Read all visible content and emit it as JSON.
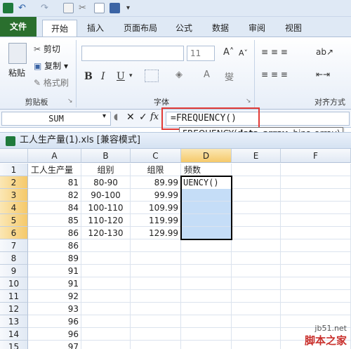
{
  "quick_access": {
    "icons": [
      "excel-icon",
      "undo-icon",
      "redo-icon",
      "print-preview-icon",
      "tools-icon",
      "new-icon",
      "save-icon",
      "customize-icon"
    ]
  },
  "ribbon_tabs": [
    {
      "label": "文件",
      "active": false
    },
    {
      "label": "开始",
      "active": true
    },
    {
      "label": "插入",
      "active": false
    },
    {
      "label": "页面布局",
      "active": false
    },
    {
      "label": "公式",
      "active": false
    },
    {
      "label": "数据",
      "active": false
    },
    {
      "label": "审阅",
      "active": false
    },
    {
      "label": "视图",
      "active": false
    }
  ],
  "ribbon": {
    "clipboard": {
      "paste_label": "粘贴",
      "cut_label": "剪切",
      "copy_label": "复制",
      "format_painter_label": "格式刷",
      "group_label": "剪贴板"
    },
    "font": {
      "font_name": "",
      "font_size": "11",
      "bold": "B",
      "italic": "I",
      "underline": "U",
      "group_label": "字体"
    },
    "alignment": {
      "group_label": "对齐方式"
    }
  },
  "formula_bar": {
    "name_box": "SUM",
    "fx_label": "fx",
    "formula": "=FREQUENCY()",
    "tooltip_func": "FREQUENCY(",
    "tooltip_arg1": "data_array",
    "tooltip_rest": ", bins_array)"
  },
  "workbook": {
    "title": "工人生产量(1).xls  [兼容模式]"
  },
  "grid": {
    "columns": [
      "A",
      "B",
      "C",
      "D",
      "E",
      "F"
    ],
    "rows": [
      {
        "n": "1",
        "a": "工人生产量",
        "b": "组别",
        "c": "组限",
        "d": "频数"
      },
      {
        "n": "2",
        "a": "81",
        "b": "80-90",
        "c": "89.99",
        "d": "UENCY()"
      },
      {
        "n": "3",
        "a": "82",
        "b": "90-100",
        "c": "99.99",
        "d": ""
      },
      {
        "n": "4",
        "a": "84",
        "b": "100-110",
        "c": "109.99",
        "d": ""
      },
      {
        "n": "5",
        "a": "85",
        "b": "110-120",
        "c": "119.99",
        "d": ""
      },
      {
        "n": "6",
        "a": "86",
        "b": "120-130",
        "c": "129.99",
        "d": ""
      },
      {
        "n": "7",
        "a": "86",
        "b": "",
        "c": "",
        "d": ""
      },
      {
        "n": "8",
        "a": "89",
        "b": "",
        "c": "",
        "d": ""
      },
      {
        "n": "9",
        "a": "91",
        "b": "",
        "c": "",
        "d": ""
      },
      {
        "n": "10",
        "a": "91",
        "b": "",
        "c": "",
        "d": ""
      },
      {
        "n": "11",
        "a": "92",
        "b": "",
        "c": "",
        "d": ""
      },
      {
        "n": "12",
        "a": "93",
        "b": "",
        "c": "",
        "d": ""
      },
      {
        "n": "13",
        "a": "96",
        "b": "",
        "c": "",
        "d": ""
      },
      {
        "n": "14",
        "a": "96",
        "b": "",
        "c": "",
        "d": ""
      },
      {
        "n": "15",
        "a": "97",
        "b": "",
        "c": "",
        "d": ""
      }
    ]
  },
  "watermark": {
    "line1": "jb51.net",
    "line2": "脚本之家"
  },
  "colors": {
    "file_tab": "#2a6f2e",
    "selection": "#c5ddf7",
    "highlight_box": "#e23a36"
  }
}
